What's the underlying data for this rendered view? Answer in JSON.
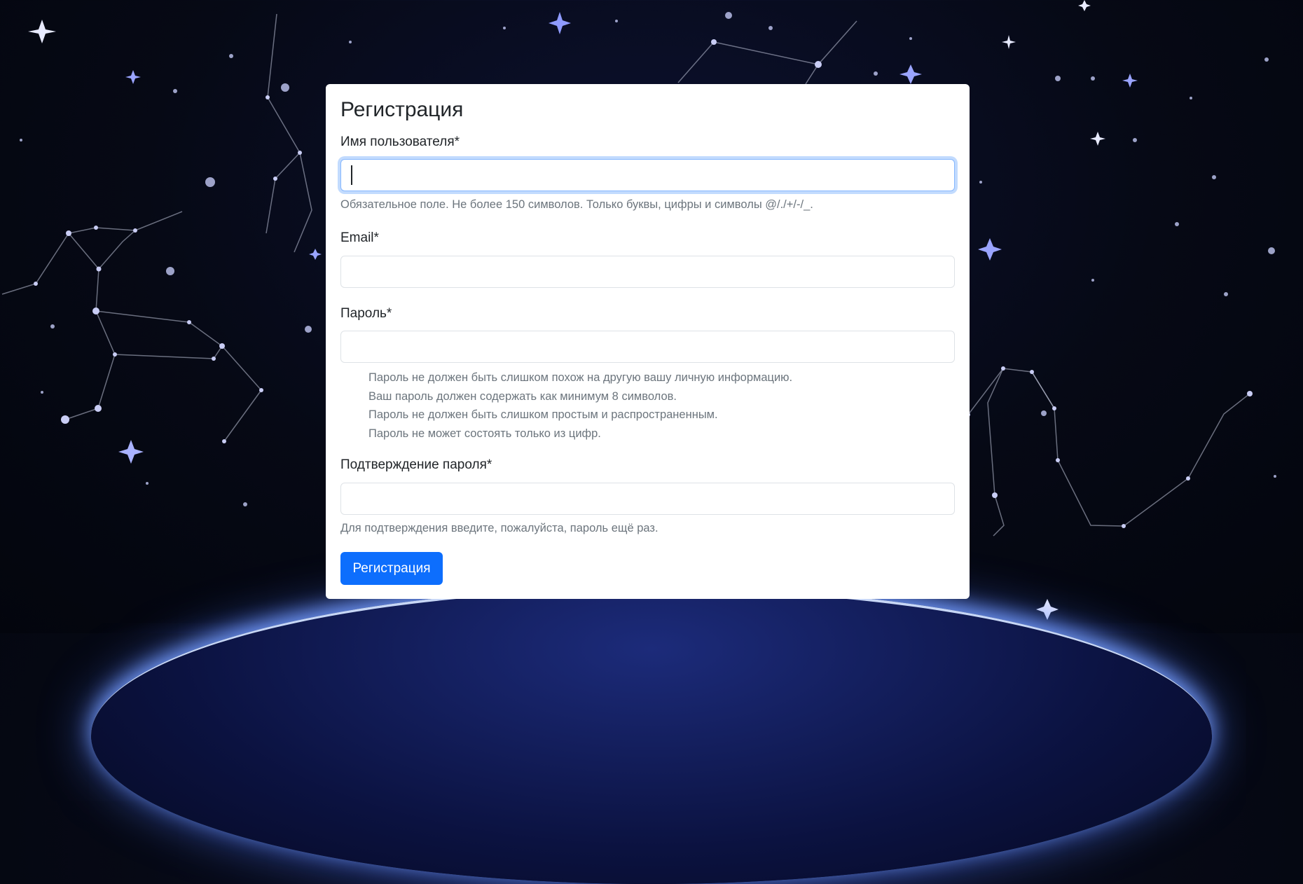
{
  "form": {
    "title": "Регистрация",
    "username": {
      "label": "Имя пользователя*",
      "value": "",
      "help": "Обязательное поле. Не более 150 символов. Только буквы, цифры и символы @/./+/-/_."
    },
    "email": {
      "label": "Email*",
      "value": ""
    },
    "password": {
      "label": "Пароль*",
      "value": "",
      "help_items": [
        "Пароль не должен быть слишком похож на другую вашу личную информацию.",
        "Ваш пароль должен содержать как минимум 8 символов.",
        "Пароль не должен быть слишком простым и распространенным.",
        "Пароль не может состоять только из цифр."
      ]
    },
    "password_confirm": {
      "label": "Подтверждение пароля*",
      "value": "",
      "help": "Для подтверждения введите, пожалуйста, пароль ещё раз."
    },
    "submit_label": "Регистрация"
  },
  "colors": {
    "primary": "#0d6efd",
    "focus_border": "#86b7fe",
    "muted_text": "#6c757d",
    "card_bg": "#ffffff"
  }
}
